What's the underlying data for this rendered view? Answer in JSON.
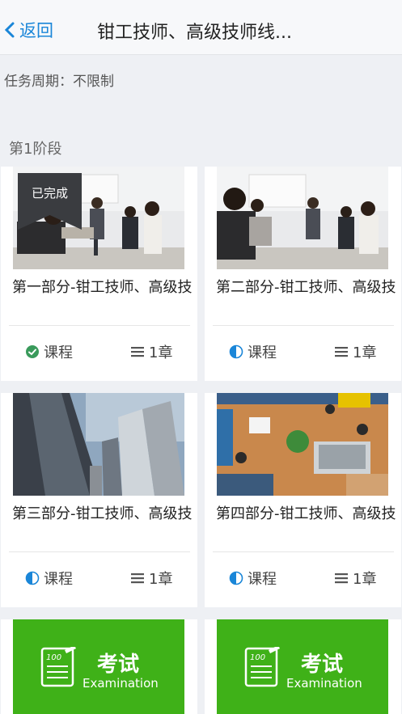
{
  "nav": {
    "back_label": "返回",
    "title": "钳工技师、高级技师线..."
  },
  "task_period": "任务周期：不限制",
  "stage_label": "第1阶段",
  "cards": [
    {
      "title": "第一部分-钳工技师、高级技",
      "badge": "已完成",
      "status_icon": "check-circle-icon",
      "type_label": "课程",
      "chapters": "1章"
    },
    {
      "title": "第二部分-钳工技师、高级技",
      "status_icon": "half-circle-icon",
      "type_label": "课程",
      "chapters": "1章"
    },
    {
      "title": "第三部分-钳工技师、高级技",
      "status_icon": "half-circle-icon",
      "type_label": "课程",
      "chapters": "1章"
    },
    {
      "title": "第四部分-钳工技师、高级技",
      "status_icon": "half-circle-icon",
      "type_label": "课程",
      "chapters": "1章"
    }
  ],
  "exams": [
    {
      "label_cn": "考试",
      "label_en": "Examination"
    },
    {
      "label_cn": "考试",
      "label_en": "Examination"
    }
  ],
  "colors": {
    "accent": "#1a86d8",
    "done_green": "#3a9a5b",
    "exam_green": "#3fb118",
    "badge_bg": "#3a3c40"
  }
}
